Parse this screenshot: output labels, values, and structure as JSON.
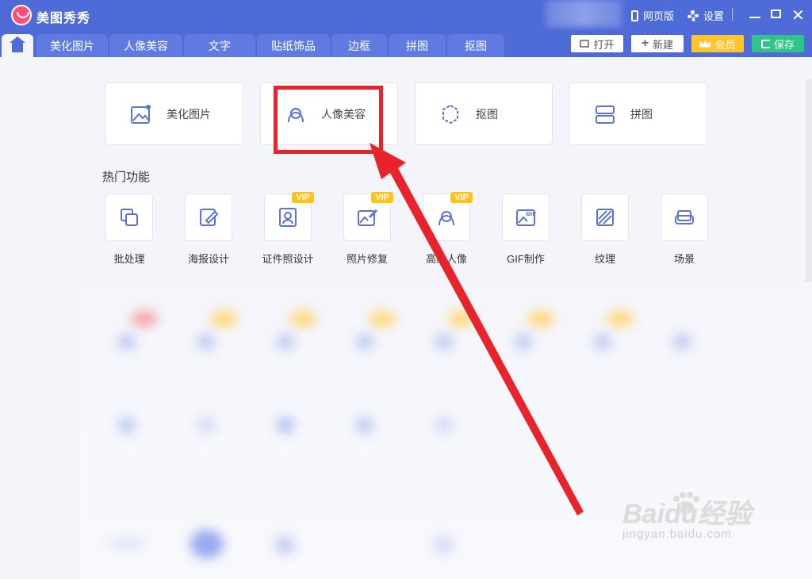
{
  "app": {
    "title": "美图秀秀"
  },
  "titlebar": {
    "web_label": "网页版",
    "settings_label": "设置"
  },
  "tabs": [
    "美化图片",
    "人像美容",
    "文字",
    "贴纸饰品",
    "边框",
    "拼图",
    "抠图"
  ],
  "actions": {
    "open": "打开",
    "new": "新建",
    "vip": "会员",
    "save": "保存"
  },
  "big_cards": [
    {
      "label": "美化图片",
      "icon": "image-icon"
    },
    {
      "label": "人像美容",
      "icon": "portrait-icon"
    },
    {
      "label": "抠图",
      "icon": "cutout-icon"
    },
    {
      "label": "拼图",
      "icon": "puzzle-icon"
    }
  ],
  "hot_section": {
    "title": "热门功能"
  },
  "tools": [
    {
      "label": "批处理",
      "icon": "batch-icon",
      "vip": ""
    },
    {
      "label": "海报设计",
      "icon": "poster-icon",
      "vip": ""
    },
    {
      "label": "证件照设计",
      "icon": "id-photo-icon",
      "vip": "VIP"
    },
    {
      "label": "照片修复",
      "icon": "photo-repair-icon",
      "vip": "VIP"
    },
    {
      "label": "高级人像",
      "icon": "portrait-icon",
      "vip": "VIP"
    },
    {
      "label": "GIF制作",
      "icon": "gif-icon",
      "vip": ""
    },
    {
      "label": "纹理",
      "icon": "texture-icon",
      "vip": ""
    },
    {
      "label": "场景",
      "icon": "scene-icon",
      "vip": ""
    }
  ],
  "watermark": {
    "main": "Baidu经验",
    "sub": "jingyan.baidu.com"
  },
  "colors": {
    "primary": "#4f6bd8",
    "vip": "#ffc21a",
    "save": "#2fc48a",
    "annotation": "#e8232b"
  }
}
